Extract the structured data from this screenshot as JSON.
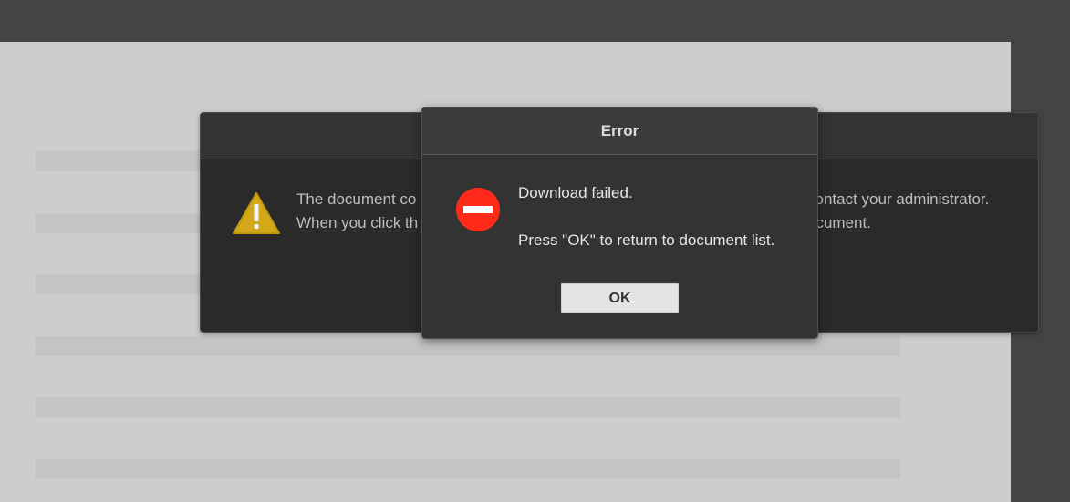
{
  "warning_dialog": {
    "text_left_line1": "The document co",
    "text_left_line2": "When you click th",
    "text_right_line1": "contact your administrator.",
    "text_right_line2": "ocument.",
    "icon": "warning-triangle-icon"
  },
  "error_dialog": {
    "title": "Error",
    "message_line1": "Download failed.",
    "message_line2": "Press \"OK\" to return to document list.",
    "ok_label": "OK",
    "icon": "error-stop-icon"
  },
  "colors": {
    "background": "#444444",
    "page": "#cdcdcd",
    "dialog": "#333333",
    "error_red": "#ff2a1a",
    "warning_yellow": "#d4a919",
    "button": "#e4e4e4"
  }
}
